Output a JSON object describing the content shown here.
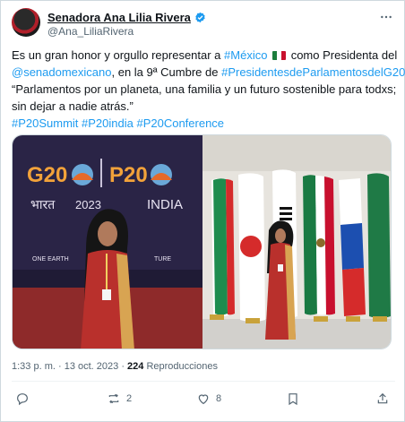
{
  "author": {
    "name": "Senadora Ana Lilia Rivera",
    "handle": "@Ana_LiliaRivera"
  },
  "tweet": {
    "line1_a": "Es un gran honor y orgullo representar a ",
    "line1_link": "#México",
    "line1_b": " como Presidenta del",
    "line2_link1": "@senadomexicano",
    "line2_mid": ", en la 9ª Cumbre de ",
    "line2_link2": "#PresidentesdeParlamentosdelG20",
    "line2_end": ",",
    "line3": "“Parlamentos por un planeta, una familia y un futuro sostenible para todxs;",
    "line4": "sin dejar a nadie atrás.”",
    "hashtags": "#P20Summit #P20india #P20Conference"
  },
  "media": {
    "left_banner": {
      "g20": "G20",
      "p20": "P20",
      "bharat": "भारत",
      "year": "2023",
      "india": "INDIA",
      "tagline_left": "ONE EARTH",
      "tagline_right": "TURE"
    }
  },
  "meta": {
    "time": "1:33 p. m.",
    "separator": " · ",
    "date": "13 oct. 2023",
    "views": "224",
    "views_label": " Reproducciones"
  },
  "actions": {
    "retweets": "2",
    "likes": "8"
  },
  "colors": {
    "link": "#1d9bf0",
    "verified": "#1d9bf0",
    "secondary_text": "#536471"
  }
}
